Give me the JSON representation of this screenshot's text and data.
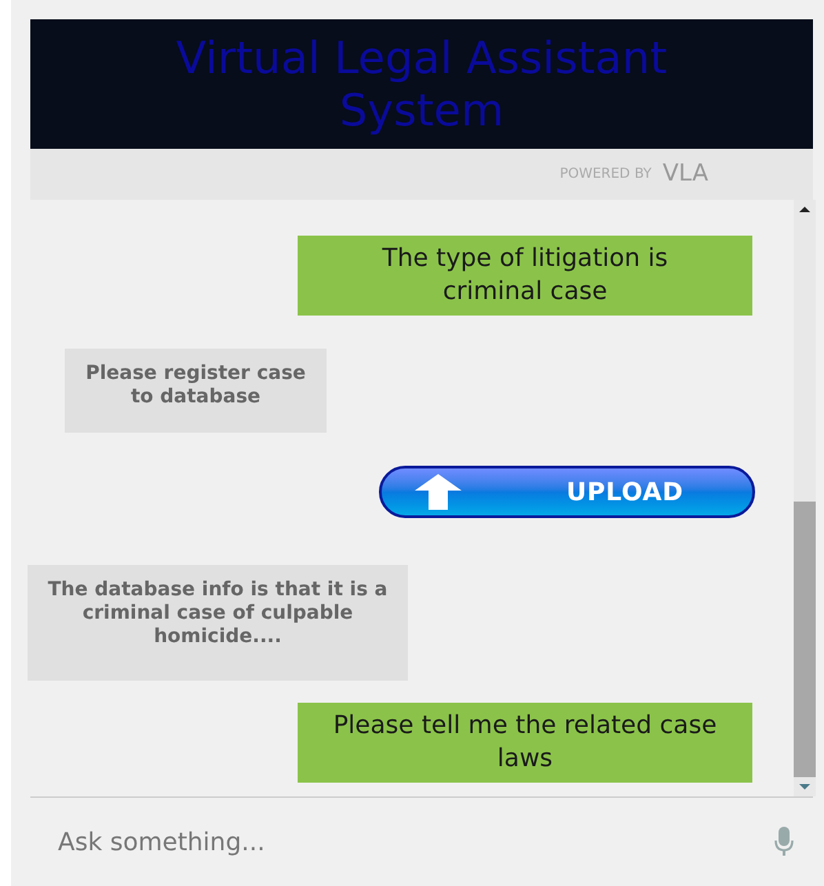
{
  "header": {
    "title": "Virtual Legal Assistant System"
  },
  "powered_by": {
    "label": "POWERED BY",
    "brand": "VLA"
  },
  "messages": [
    {
      "kind": "user",
      "text": "The type of litigation is criminal case"
    },
    {
      "kind": "bot",
      "text": "Please register case to database"
    },
    {
      "kind": "upload",
      "text": "UPLOAD"
    },
    {
      "kind": "bot",
      "text": "The database info is that it is a criminal case of culpable homicide...."
    },
    {
      "kind": "user",
      "text": "Please tell me the related case laws"
    }
  ],
  "input": {
    "placeholder": "Ask something..."
  }
}
